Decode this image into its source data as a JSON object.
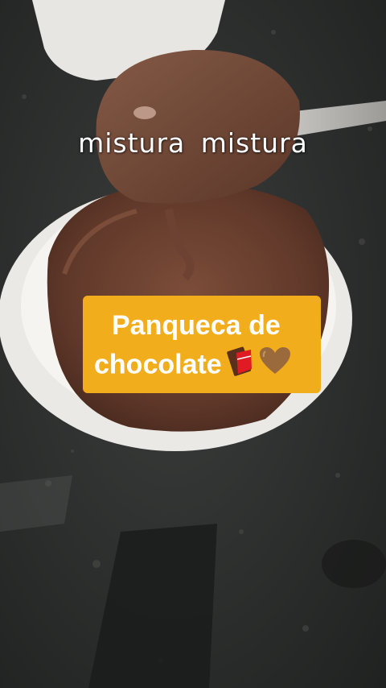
{
  "overlay": {
    "caption": "mistura mistura",
    "title_line1": "Panqueca de",
    "title_line2": "chocolate",
    "title_emojis": [
      "chocolate-bar-emoji",
      "brown-heart-emoji"
    ]
  },
  "colors": {
    "countertop": "#2b2d2c",
    "bowl": "#f1efec",
    "batter": "#6a4030",
    "title_box": "#f2ad1c",
    "text": "#ffffff"
  }
}
